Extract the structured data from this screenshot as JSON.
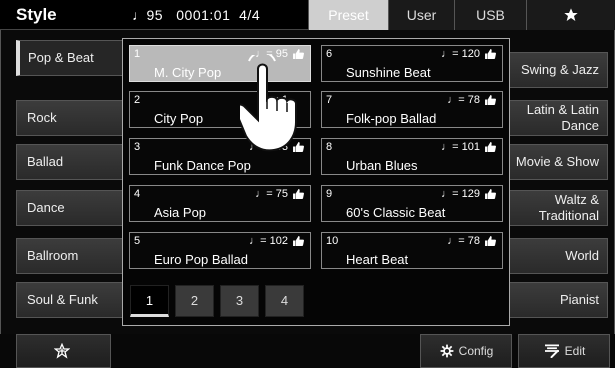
{
  "header": {
    "title": "Style",
    "tempo": "♩95",
    "measure": "0001:01",
    "time_sig": "4/4",
    "tabs": [
      "Preset",
      "User",
      "USB"
    ],
    "favorites_icon": "star-icon"
  },
  "categories_left": [
    {
      "label": "Pop & Beat",
      "selected": true
    },
    {
      "label": "Rock"
    },
    {
      "label": "Ballad"
    },
    {
      "label": "Dance"
    },
    {
      "label": "Ballroom"
    },
    {
      "label": "Soul & Funk"
    }
  ],
  "categories_right": [
    {
      "label": "Swing & Jazz"
    },
    {
      "label": "Latin & Latin Dance"
    },
    {
      "label": "Movie & Show"
    },
    {
      "label": "Waltz & Traditional"
    },
    {
      "label": "World"
    },
    {
      "label": "Pianist"
    }
  ],
  "styles": [
    {
      "num": "1",
      "tempo": "♩= 95",
      "name": "M. City Pop",
      "selected": true
    },
    {
      "num": "2",
      "tempo": "♩= 1",
      "name": "City Pop"
    },
    {
      "num": "3",
      "tempo": "♩= 103",
      "name": "Funk Dance Pop"
    },
    {
      "num": "4",
      "tempo": "♩= 75",
      "name": "Asia Pop"
    },
    {
      "num": "5",
      "tempo": "♩= 102",
      "name": "Euro Pop Ballad"
    },
    {
      "num": "6",
      "tempo": "♩= 120",
      "name": "Sunshine Beat"
    },
    {
      "num": "7",
      "tempo": "♩= 78",
      "name": "Folk-pop Ballad"
    },
    {
      "num": "8",
      "tempo": "♩= 101",
      "name": "Urban Blues"
    },
    {
      "num": "9",
      "tempo": "♩= 129",
      "name": "60's Classic Beat"
    },
    {
      "num": "10",
      "tempo": "♩= 78",
      "name": "Heart Beat"
    }
  ],
  "pages": [
    "1",
    "2",
    "3",
    "4"
  ],
  "selected_page": "1",
  "bottom": {
    "config_label": "Config",
    "edit_label": "Edit"
  }
}
